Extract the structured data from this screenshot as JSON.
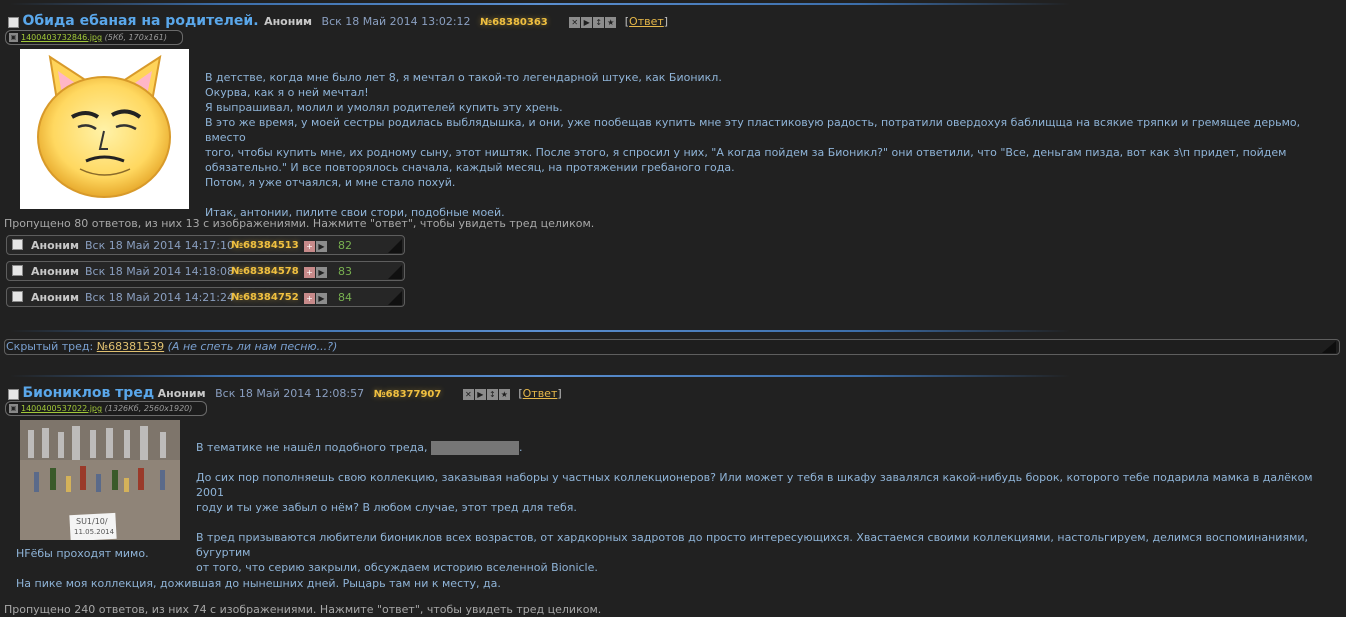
{
  "colors": {
    "background": "#212121",
    "title": "#5aa7ea",
    "post_number": "#f0c040",
    "message": "#8fb4d8",
    "reply_link": "#e6b84a",
    "reply_count": "#78b050"
  },
  "thread1": {
    "title": "Обида ебаная на родителей.",
    "author": "Аноним",
    "date": "Вск 18 Май 2014 13:02:12",
    "post_number": "№68380363",
    "reply_label": "Ответ",
    "file_name": "1400403732846.jpg",
    "file_meta": "(5Кб, 170x161)",
    "message": [
      "В детстве, когда мне было лет 8, я мечтал о такой-то легендарной штуке, как Бионикл.",
      "Окурва, как я о ней мечтал!",
      "Я выпрашивал, молил и умолял родителей купить эту хрень.",
      "В это же время, у моей сестры родилась выблядышка, и они, уже пообещав купить мне эту пластиковую радость, потратили овердохуя баблищща на всякие тряпки и гремящее дерьмо, вместо",
      "того, чтобы купить мне, их родному сыну, этот ништяк. После этого, я спросил у них, \"А когда пойдем за Бионикл?\" они ответили, что \"Все, деньгам пизда, вот как з\\п придет, пойдем",
      "обязательно.\" И все повторялось сначала, каждый месяц, на протяжении гребаного года.",
      "Потом, я уже отчаялся, и мне стало похуй.",
      "",
      "Итак, антонии, пилите свои стори, подобные моей."
    ],
    "omitted": "Пропущено 80 ответов, из них 13 с изображениями. Нажмите \"ответ\", чтобы увидеть тред целиком.",
    "replies": [
      {
        "author": "Аноним",
        "date": "Вск 18 Май 2014 14:17:10",
        "post_number": "№68384513",
        "count": "82"
      },
      {
        "author": "Аноним",
        "date": "Вск 18 Май 2014 14:18:08",
        "post_number": "№68384578",
        "count": "83"
      },
      {
        "author": "Аноним",
        "date": "Вск 18 Май 2014 14:21:24",
        "post_number": "№68384752",
        "count": "84"
      }
    ]
  },
  "hidden_thread": {
    "label": "Скрытый тред:",
    "number": "№68381539",
    "comment": "(А не спеть ли нам песню...?)"
  },
  "thread2": {
    "title": "Биониклов тред",
    "author": "Аноним",
    "date": "Вск 18 Май 2014 12:08:57",
    "post_number": "№68377907",
    "reply_label": "Ответ",
    "file_name": "1400400537022.jpg",
    "file_meta": "(1326Кб, 2560x1920)",
    "message": [
      "В тематике не нашёл подобного треда,",
      "",
      "До сих пор пополняешь свою коллекцию, заказывая наборы у частных коллекционеров? Или может у тебя в шкафу завалялся какой-нибудь борок, которого тебе подарила мамка в далёком 2001",
      "году и ты уже забыл о нём? В любом случае, этот тред для тебя.",
      "",
      "В тред призываются любители биониклов всех возрастов, от хардкорных задротов до просто интересующихся. Хвастаемся своими коллекциями, настольгируем, делимся воспоминаниями, бугуртим",
      "от того, что серию закрыли, обсуждаем историю вселенной Bionicle.",
      "НFёбы проходят мимо.",
      "",
      "На пике моя коллекция, дожившая до нынешних дней. Рыцарь там ни к месту, да."
    ],
    "photo_note": [
      "SU1/10/",
      "11.05.2014"
    ],
    "omitted": "Пропущено 240 ответов, из них 74 с изображениями. Нажмите \"ответ\", чтобы увидеть тред целиком."
  }
}
